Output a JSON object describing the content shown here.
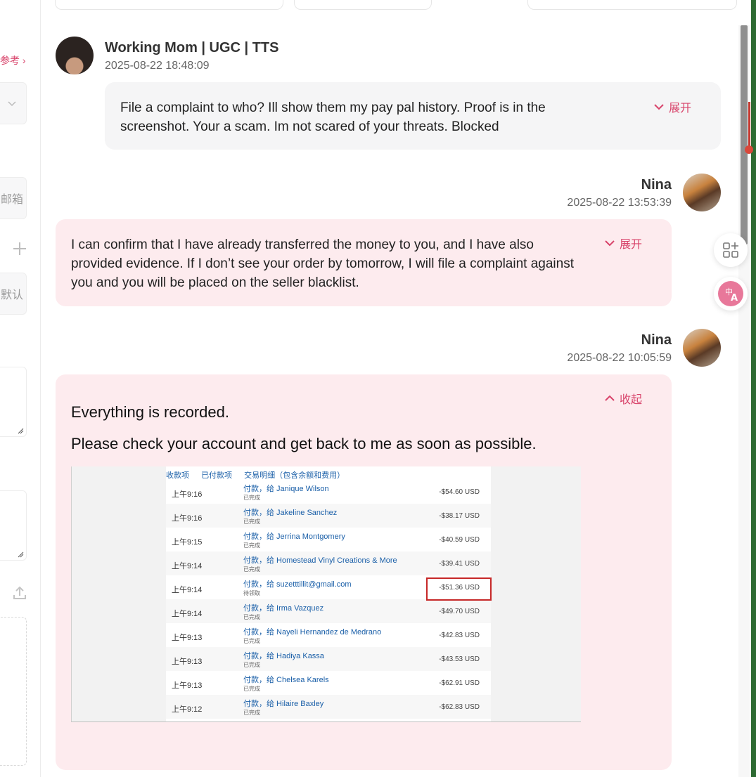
{
  "left": {
    "ref_link": "参考",
    "email_fragment": "邮箱",
    "default_fragment": "默认"
  },
  "messages": [
    {
      "sender": "Working Mom | UGC | TTS",
      "time": "2025-08-22 18:48:09",
      "text": "File a complaint to who? Ill show them my pay pal history. Proof is in the screenshot. Your a scam. Im not scared of your threats. Blocked",
      "toggle": "展开"
    },
    {
      "sender": "Nina",
      "time": "2025-08-22 13:53:39",
      "text": "I can confirm that I have already transferred the money to you, and I have also provided evidence. If I don’t see your order by tomorrow, I will file a complaint against you and you will be placed on the seller blacklist.",
      "toggle": "展开"
    },
    {
      "sender": "Nina",
      "time": "2025-08-22 10:05:59",
      "line1": "Everything is recorded.",
      "line2": "Please check your account and get back to me as soon as possible.",
      "toggle": "收起"
    }
  ],
  "screenshot": {
    "tabs": [
      "收款项",
      "已付款项",
      "交易明细（包含余额和费用）"
    ],
    "rows": [
      {
        "time": "上午9:16",
        "payee": "付款，给 Janique Wilson",
        "status": "已完成",
        "amount": "-$54.60 USD"
      },
      {
        "time": "上午9:16",
        "payee": "付款，给 Jakeline Sanchez",
        "status": "已完成",
        "amount": "-$38.17 USD"
      },
      {
        "time": "上午9:15",
        "payee": "付款，给 Jerrina Montgomery",
        "status": "已完成",
        "amount": "-$40.59 USD"
      },
      {
        "time": "上午9:14",
        "payee": "付款，给 Homestead Vinyl Creations & More",
        "status": "已完成",
        "amount": "-$39.41 USD"
      },
      {
        "time": "上午9:14",
        "payee": "付款，给 suzetttillit@gmail.com",
        "status": "待领取",
        "amount": "-$51.36 USD"
      },
      {
        "time": "上午9:14",
        "payee": "付款，给 Irma Vazquez",
        "status": "已完成",
        "amount": "-$49.70 USD"
      },
      {
        "time": "上午9:13",
        "payee": "付款，给 Nayeli Hernandez de Medrano",
        "status": "已完成",
        "amount": "-$42.83 USD"
      },
      {
        "time": "上午9:13",
        "payee": "付款，给 Hadiya Kassa",
        "status": "已完成",
        "amount": "-$43.53 USD"
      },
      {
        "time": "上午9:13",
        "payee": "付款，给 Chelsea Karels",
        "status": "已完成",
        "amount": "-$62.91 USD"
      },
      {
        "time": "上午9:12",
        "payee": "付款，给 Hilaire Baxley",
        "status": "已完成",
        "amount": "-$62.83 USD"
      }
    ]
  },
  "colors": {
    "accent": "#d8436a",
    "pink_bubble": "#fdebee",
    "grey_bubble": "#f5f5f6"
  }
}
